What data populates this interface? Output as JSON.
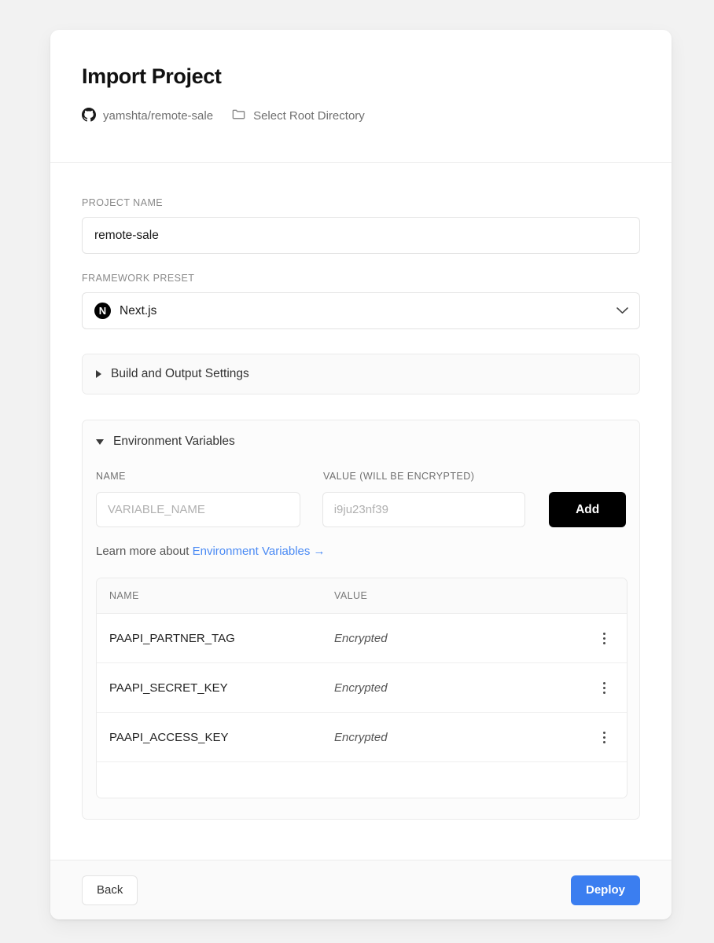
{
  "header": {
    "title": "Import Project",
    "repo": {
      "icon": "github-icon",
      "label": "yamshta/remote-sale"
    },
    "root_directory": {
      "icon": "folder-icon",
      "label": "Select Root Directory"
    }
  },
  "form": {
    "project_name": {
      "label": "PROJECT NAME",
      "value": "remote-sale",
      "placeholder": ""
    },
    "framework_preset": {
      "label": "FRAMEWORK PRESET",
      "selected": "Next.js",
      "logo_letter": "N",
      "chevron_icon": "chevron-down-icon"
    }
  },
  "build_settings": {
    "label": "Build and Output Settings",
    "expanded": false,
    "toggle_icon": "triangle-right-icon"
  },
  "environment_variables": {
    "label": "Environment Variables",
    "expanded": true,
    "toggle_icon": "triangle-down-icon",
    "column_headers": {
      "name": "NAME",
      "value": "VALUE (WILL BE ENCRYPTED)"
    },
    "inputs": {
      "name_placeholder": "VARIABLE_NAME",
      "name_value": "",
      "value_placeholder": "i9ju23nf39",
      "value_value": ""
    },
    "add_button": "Add",
    "learn_more_prefix": "Learn more about",
    "learn_more_link": "Environment Variables →",
    "table": {
      "headers": [
        "NAME",
        "VALUE"
      ],
      "rows": [
        {
          "name": "PAAPI_PARTNER_TAG",
          "value": "Encrypted",
          "menu_icon": "kebab-menu-icon"
        },
        {
          "name": "PAAPI_SECRET_KEY",
          "value": "Encrypted",
          "menu_icon": "kebab-menu-icon"
        },
        {
          "name": "PAAPI_ACCESS_KEY",
          "value": "Encrypted",
          "menu_icon": "kebab-menu-icon"
        }
      ]
    }
  },
  "footer": {
    "back_label": "Back",
    "deploy_label": "Deploy"
  },
  "colors": {
    "accent_blue": "#3b7ef0",
    "link_blue": "#4a8af4",
    "add_button_black": "#000000",
    "page_background": "#f2f2f2",
    "card_background": "#ffffff"
  }
}
